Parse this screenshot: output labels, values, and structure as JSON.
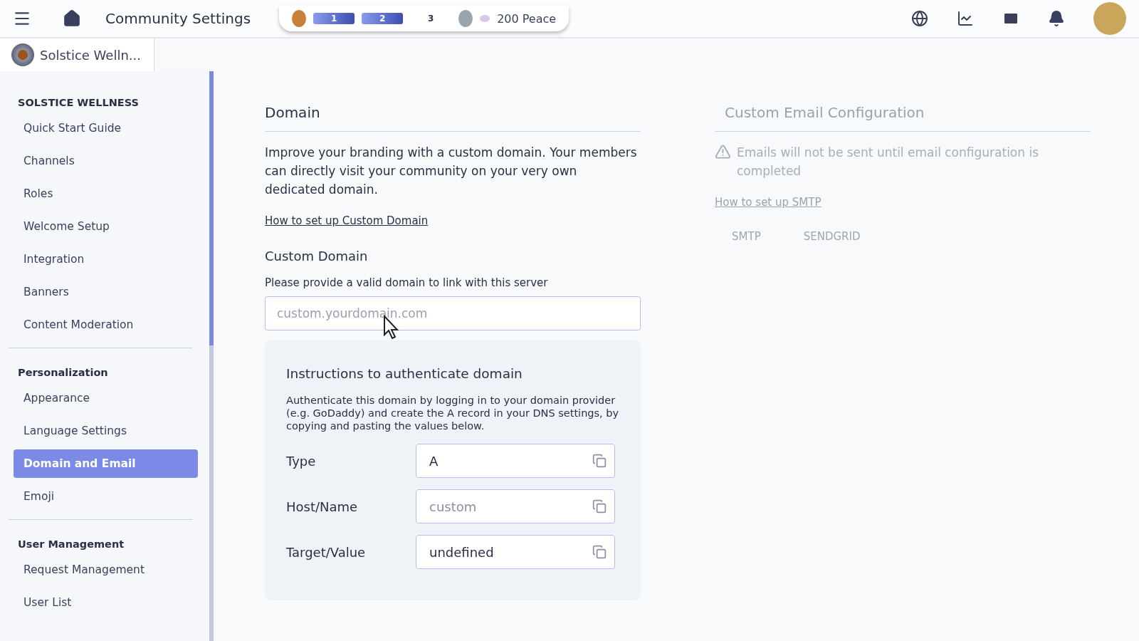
{
  "header": {
    "title": "Community Settings",
    "levels": [
      {
        "label": "1",
        "filled": true
      },
      {
        "label": "2",
        "filled": true
      },
      {
        "label": "3",
        "filled": false
      }
    ],
    "points": "200 Peace"
  },
  "community_tab": {
    "name": "Solstice Welln..."
  },
  "sidebar": {
    "sections": [
      {
        "title": "SOLSTICE WELLNESS",
        "items": [
          {
            "label": "Quick Start Guide",
            "selected": false
          },
          {
            "label": "Channels",
            "selected": false
          },
          {
            "label": "Roles",
            "selected": false
          },
          {
            "label": "Welcome Setup",
            "selected": false
          },
          {
            "label": "Integration",
            "selected": false
          },
          {
            "label": "Banners",
            "selected": false
          },
          {
            "label": "Content Moderation",
            "selected": false
          }
        ]
      },
      {
        "title": "Personalization",
        "items": [
          {
            "label": "Appearance",
            "selected": false
          },
          {
            "label": "Language Settings",
            "selected": false
          },
          {
            "label": "Domain and Email",
            "selected": true
          },
          {
            "label": "Emoji",
            "selected": false
          }
        ]
      },
      {
        "title": "User Management",
        "items": [
          {
            "label": "Request Management",
            "selected": false
          },
          {
            "label": "User List",
            "selected": false
          }
        ]
      }
    ]
  },
  "domain": {
    "title": "Domain",
    "description": "Improve your branding with a custom domain. Your members can directly visit your community on your very own dedicated domain.",
    "link": "How to set up Custom Domain",
    "field_label": "Custom Domain",
    "field_hint": "Please provide a valid domain to link with this server",
    "placeholder": "custom.yourdomain.com",
    "instructions": {
      "title": "Instructions to authenticate domain",
      "text": "Authenticate this domain by logging in to your domain provider (e.g. GoDaddy) and create the A record in your DNS settings, by copying and pasting the values below.",
      "records": [
        {
          "label": "Type",
          "value": "A"
        },
        {
          "label": "Host/Name",
          "placeholder": "custom"
        },
        {
          "label": "Target/Value",
          "value": "undefined"
        }
      ]
    }
  },
  "email": {
    "title": "Custom Email Configuration",
    "warning": "Emails will not be sent until email configuration is completed",
    "link": "How to set up SMTP",
    "tabs": [
      {
        "label": "SMTP",
        "selected": false
      },
      {
        "label": "SENDGRID",
        "selected": false
      }
    ]
  }
}
